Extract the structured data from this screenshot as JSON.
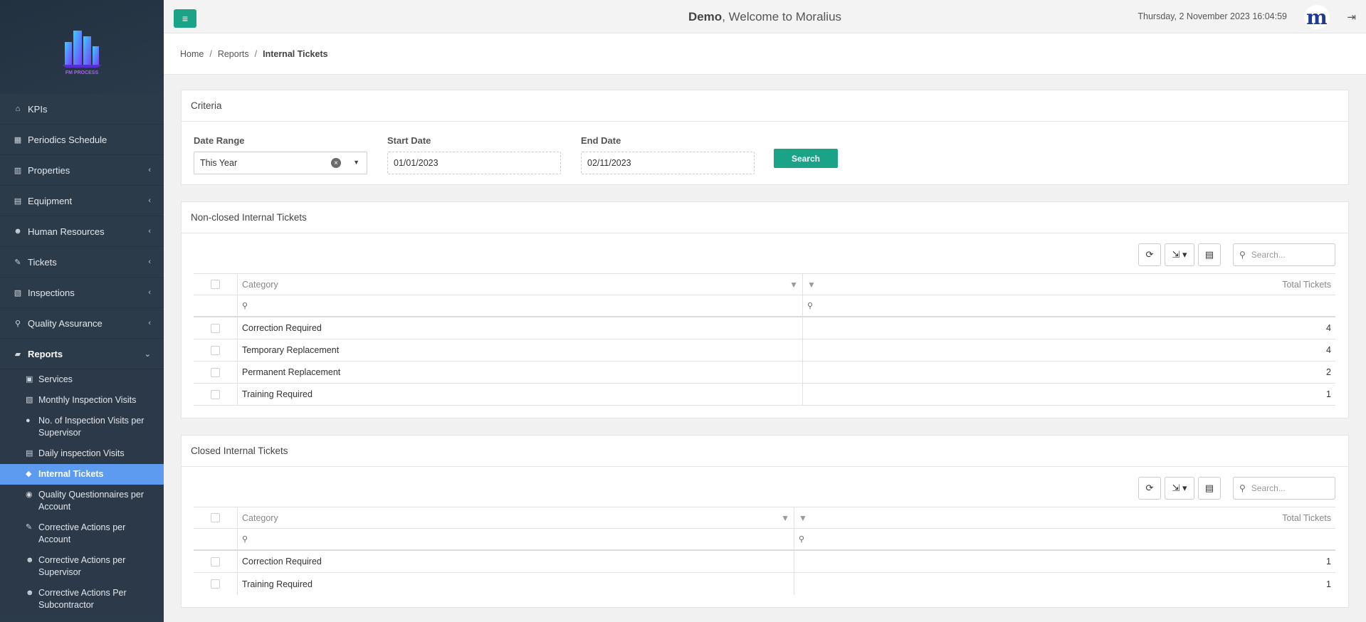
{
  "header": {
    "menu_icon": "bars-icon",
    "welcome_user": "Demo",
    "welcome_text": ", Welcome to Moralius",
    "datetime": "Thursday, 2 November 2023 16:04:59",
    "brand_letter": "m"
  },
  "sidebar": {
    "logo_caption": "FM PROCESS",
    "items": [
      {
        "label": "KPIs",
        "icon": "home-icon",
        "glyph": "⌂"
      },
      {
        "label": "Periodics Schedule",
        "icon": "calendar-icon",
        "glyph": "▦"
      },
      {
        "label": "Properties",
        "icon": "building-icon",
        "glyph": "▥"
      },
      {
        "label": "Equipment",
        "icon": "book-icon",
        "glyph": "▤"
      },
      {
        "label": "Human Resources",
        "icon": "users-icon",
        "glyph": "☻"
      },
      {
        "label": "Tickets",
        "icon": "ticket-icon",
        "glyph": "✎"
      },
      {
        "label": "Inspections",
        "icon": "map-icon",
        "glyph": "▧"
      },
      {
        "label": "Quality Assurance",
        "icon": "search-icon",
        "glyph": "⚲"
      },
      {
        "label": "Reports",
        "icon": "book-open-icon",
        "glyph": "▰"
      }
    ],
    "sub_items": [
      {
        "label": "Services",
        "icon": "calendar-check-icon",
        "glyph": "▣"
      },
      {
        "label": "Monthly Inspection Visits",
        "icon": "map-icon",
        "glyph": "▧"
      },
      {
        "label": "No. of Inspection Visits per Supervisor",
        "icon": "user-circle-icon",
        "glyph": "●"
      },
      {
        "label": "Daily inspection Visits",
        "icon": "book-icon",
        "glyph": "▤"
      },
      {
        "label": "Internal Tickets",
        "icon": "tag-icon",
        "glyph": "◆"
      },
      {
        "label": "Quality Questionnaires per Account",
        "icon": "arrow-circle-icon",
        "glyph": "◉"
      },
      {
        "label": "Corrective Actions per Account",
        "icon": "wrench-icon",
        "glyph": "✎"
      },
      {
        "label": "Corrective Actions per Supervisor",
        "icon": "users-icon",
        "glyph": "☻"
      },
      {
        "label": "Corrective Actions Per Subcontractor",
        "icon": "users-icon",
        "glyph": "☻"
      }
    ]
  },
  "breadcrumb": {
    "home": "Home",
    "reports": "Reports",
    "current": "Internal Tickets"
  },
  "criteria": {
    "title": "Criteria",
    "date_range_label": "Date Range",
    "date_range_value": "This Year",
    "start_label": "Start Date",
    "start_value": "01/01/2023",
    "end_label": "End Date",
    "end_value": "02/11/2023",
    "search_label": "Search"
  },
  "non_closed": {
    "title": "Non-closed Internal Tickets",
    "search_placeholder": "Search...",
    "col_category": "Category",
    "col_total": "Total Tickets",
    "rows": [
      {
        "category": "Correction Required",
        "total": "4"
      },
      {
        "category": "Temporary Replacement",
        "total": "4"
      },
      {
        "category": "Permanent Replacement",
        "total": "2"
      },
      {
        "category": "Training Required",
        "total": "1"
      }
    ]
  },
  "closed": {
    "title": "Closed Internal Tickets",
    "search_placeholder": "Search...",
    "col_category": "Category",
    "col_total": "Total Tickets",
    "rows": [
      {
        "category": "Correction Required",
        "total": "1"
      },
      {
        "category": "Training Required",
        "total": "1"
      }
    ]
  }
}
